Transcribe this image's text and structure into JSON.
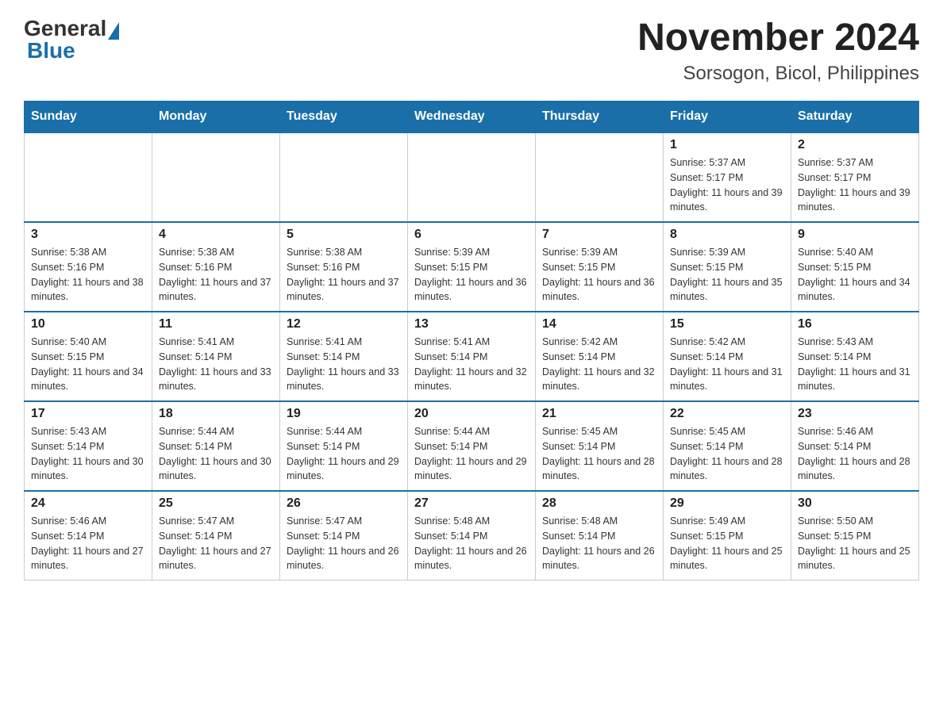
{
  "logo": {
    "general": "General",
    "blue": "Blue"
  },
  "title": "November 2024",
  "subtitle": "Sorsogon, Bicol, Philippines",
  "days_of_week": [
    "Sunday",
    "Monday",
    "Tuesday",
    "Wednesday",
    "Thursday",
    "Friday",
    "Saturday"
  ],
  "weeks": [
    [
      {
        "day": "",
        "info": ""
      },
      {
        "day": "",
        "info": ""
      },
      {
        "day": "",
        "info": ""
      },
      {
        "day": "",
        "info": ""
      },
      {
        "day": "",
        "info": ""
      },
      {
        "day": "1",
        "info": "Sunrise: 5:37 AM\nSunset: 5:17 PM\nDaylight: 11 hours and 39 minutes."
      },
      {
        "day": "2",
        "info": "Sunrise: 5:37 AM\nSunset: 5:17 PM\nDaylight: 11 hours and 39 minutes."
      }
    ],
    [
      {
        "day": "3",
        "info": "Sunrise: 5:38 AM\nSunset: 5:16 PM\nDaylight: 11 hours and 38 minutes."
      },
      {
        "day": "4",
        "info": "Sunrise: 5:38 AM\nSunset: 5:16 PM\nDaylight: 11 hours and 37 minutes."
      },
      {
        "day": "5",
        "info": "Sunrise: 5:38 AM\nSunset: 5:16 PM\nDaylight: 11 hours and 37 minutes."
      },
      {
        "day": "6",
        "info": "Sunrise: 5:39 AM\nSunset: 5:15 PM\nDaylight: 11 hours and 36 minutes."
      },
      {
        "day": "7",
        "info": "Sunrise: 5:39 AM\nSunset: 5:15 PM\nDaylight: 11 hours and 36 minutes."
      },
      {
        "day": "8",
        "info": "Sunrise: 5:39 AM\nSunset: 5:15 PM\nDaylight: 11 hours and 35 minutes."
      },
      {
        "day": "9",
        "info": "Sunrise: 5:40 AM\nSunset: 5:15 PM\nDaylight: 11 hours and 34 minutes."
      }
    ],
    [
      {
        "day": "10",
        "info": "Sunrise: 5:40 AM\nSunset: 5:15 PM\nDaylight: 11 hours and 34 minutes."
      },
      {
        "day": "11",
        "info": "Sunrise: 5:41 AM\nSunset: 5:14 PM\nDaylight: 11 hours and 33 minutes."
      },
      {
        "day": "12",
        "info": "Sunrise: 5:41 AM\nSunset: 5:14 PM\nDaylight: 11 hours and 33 minutes."
      },
      {
        "day": "13",
        "info": "Sunrise: 5:41 AM\nSunset: 5:14 PM\nDaylight: 11 hours and 32 minutes."
      },
      {
        "day": "14",
        "info": "Sunrise: 5:42 AM\nSunset: 5:14 PM\nDaylight: 11 hours and 32 minutes."
      },
      {
        "day": "15",
        "info": "Sunrise: 5:42 AM\nSunset: 5:14 PM\nDaylight: 11 hours and 31 minutes."
      },
      {
        "day": "16",
        "info": "Sunrise: 5:43 AM\nSunset: 5:14 PM\nDaylight: 11 hours and 31 minutes."
      }
    ],
    [
      {
        "day": "17",
        "info": "Sunrise: 5:43 AM\nSunset: 5:14 PM\nDaylight: 11 hours and 30 minutes."
      },
      {
        "day": "18",
        "info": "Sunrise: 5:44 AM\nSunset: 5:14 PM\nDaylight: 11 hours and 30 minutes."
      },
      {
        "day": "19",
        "info": "Sunrise: 5:44 AM\nSunset: 5:14 PM\nDaylight: 11 hours and 29 minutes."
      },
      {
        "day": "20",
        "info": "Sunrise: 5:44 AM\nSunset: 5:14 PM\nDaylight: 11 hours and 29 minutes."
      },
      {
        "day": "21",
        "info": "Sunrise: 5:45 AM\nSunset: 5:14 PM\nDaylight: 11 hours and 28 minutes."
      },
      {
        "day": "22",
        "info": "Sunrise: 5:45 AM\nSunset: 5:14 PM\nDaylight: 11 hours and 28 minutes."
      },
      {
        "day": "23",
        "info": "Sunrise: 5:46 AM\nSunset: 5:14 PM\nDaylight: 11 hours and 28 minutes."
      }
    ],
    [
      {
        "day": "24",
        "info": "Sunrise: 5:46 AM\nSunset: 5:14 PM\nDaylight: 11 hours and 27 minutes."
      },
      {
        "day": "25",
        "info": "Sunrise: 5:47 AM\nSunset: 5:14 PM\nDaylight: 11 hours and 27 minutes."
      },
      {
        "day": "26",
        "info": "Sunrise: 5:47 AM\nSunset: 5:14 PM\nDaylight: 11 hours and 26 minutes."
      },
      {
        "day": "27",
        "info": "Sunrise: 5:48 AM\nSunset: 5:14 PM\nDaylight: 11 hours and 26 minutes."
      },
      {
        "day": "28",
        "info": "Sunrise: 5:48 AM\nSunset: 5:14 PM\nDaylight: 11 hours and 26 minutes."
      },
      {
        "day": "29",
        "info": "Sunrise: 5:49 AM\nSunset: 5:15 PM\nDaylight: 11 hours and 25 minutes."
      },
      {
        "day": "30",
        "info": "Sunrise: 5:50 AM\nSunset: 5:15 PM\nDaylight: 11 hours and 25 minutes."
      }
    ]
  ]
}
